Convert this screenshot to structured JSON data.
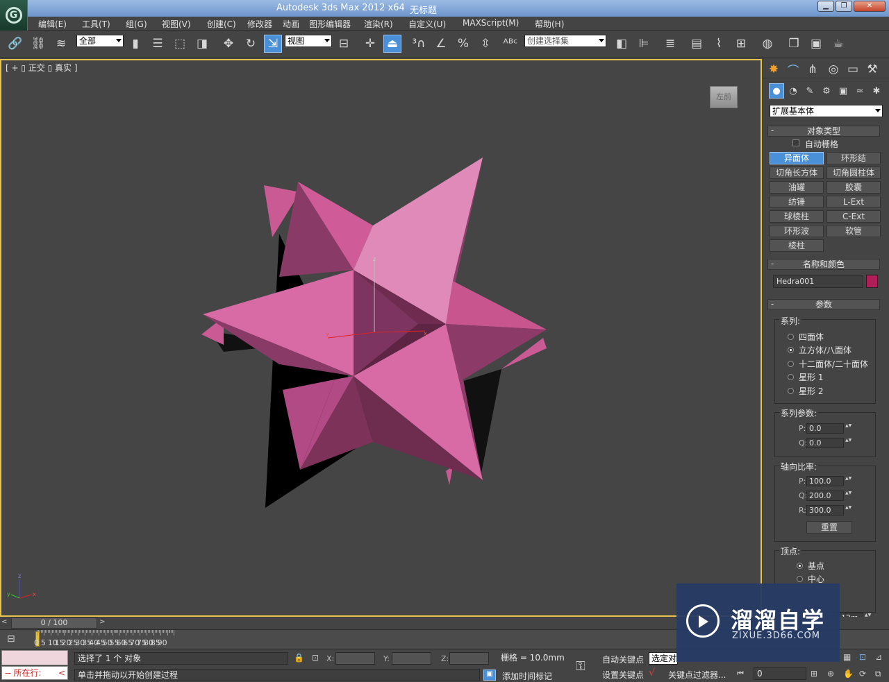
{
  "window": {
    "title": "Autodesk 3ds Max  2012 x64",
    "doc_title": "无标题"
  },
  "menu": [
    "编辑(E)",
    "工具(T)",
    "组(G)",
    "视图(V)",
    "创建(C)",
    "修改器",
    "动画",
    "图形编辑器",
    "渲染(R)",
    "自定义(U)",
    "MAXScript(M)",
    "帮助(H)"
  ],
  "toolbar": {
    "filter_value": "全部",
    "refcoord_value": "视图",
    "named_sel_value": "创建选择集"
  },
  "viewport": {
    "label": "[ + ▯ 正交 ▯ 真实 ]",
    "viewcube_label": "左前",
    "axis_x": "x",
    "axis_y": "y",
    "axis_z": "z"
  },
  "command_panel": {
    "category_value": "扩展基本体",
    "object_type_header": "对象类型",
    "autogrid_label": "自动栅格",
    "object_buttons": [
      "异面体",
      "环形结",
      "切角长方体",
      "切角圆柱体",
      "油罐",
      "胶囊",
      "纺锤",
      "L-Ext",
      "球棱柱",
      "C-Ext",
      "环形波",
      "软管",
      "棱柱"
    ],
    "selected_button": "异面体",
    "name_color_header": "名称和颜色",
    "object_name": "Hedra001",
    "object_color": "#b01e5a",
    "params_header": "参数",
    "family_label": "系列:",
    "family_options": [
      "四面体",
      "立方体/八面体",
      "十二面体/二十面体",
      "星形 1",
      "星形 2"
    ],
    "family_selected": "立方体/八面体",
    "family_params_label": "系列参数:",
    "p_label": "P:",
    "p_value": "0.0",
    "q_label": "Q:",
    "q_value": "0.0",
    "axis_scale_label": "轴向比率:",
    "axis_p_label": "P:",
    "axis_p": "100.0",
    "axis_q_label": "Q:",
    "axis_q": "200.0",
    "axis_r_label": "R:",
    "axis_r": "300.0",
    "reset_label": "重置",
    "vertex_label": "顶点:",
    "vertex_options": [
      "基点",
      "中心"
    ],
    "vertex_selected": "基点",
    "radius_partial": "12m"
  },
  "timeline": {
    "frame_readout": "0 / 100",
    "ticks": [
      "0",
      "5",
      "10",
      "15",
      "20",
      "25",
      "30",
      "35",
      "40",
      "45",
      "50",
      "55",
      "60",
      "65",
      "70",
      "75",
      "80",
      "85",
      "90"
    ]
  },
  "status": {
    "maxscript_listener": "所在行:",
    "selected_text": "选择了 1 个 对象",
    "prompt_text": "单击并拖动以开始创建过程",
    "x_label": "X:",
    "y_label": "Y:",
    "z_label": "Z:",
    "grid_text": "栅格 = 10.0mm",
    "add_time_tag": "添加时间标记",
    "auto_key": "自动关键点",
    "set_key": "设置关键点",
    "selection_dropdown": "选定对",
    "key_filters": "关键点过滤器...",
    "frame_field": "0"
  },
  "watermark": {
    "cn": "溜溜自学",
    "en": "ZIXUE.3D66.COM"
  },
  "colors": {
    "accent_blue": "#4a90d8",
    "viewport_border": "#e6c34d",
    "object_pink": "#d35a9a"
  }
}
